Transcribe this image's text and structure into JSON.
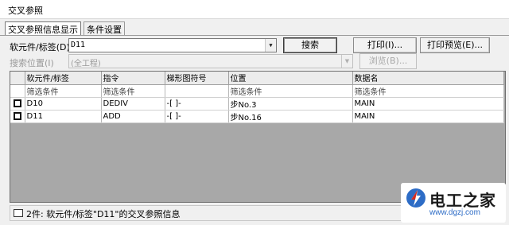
{
  "window": {
    "title": "交叉参照"
  },
  "tabs": [
    {
      "label": "交叉参照信息显示",
      "active": true
    },
    {
      "label": "条件设置",
      "active": false
    }
  ],
  "search": {
    "device_label": "软元件/标签(D)",
    "device_value": "D11",
    "search_button": "搜索",
    "location_label": "搜索位置(I)",
    "location_value": "(全工程)",
    "browse_button": "浏览(B)...",
    "print_button": "打印(I)...",
    "print_preview_button": "打印预览(E)..."
  },
  "grid": {
    "columns": [
      "软元件/标签",
      "指令",
      "梯形图符号",
      "位置",
      "数据名"
    ],
    "filter_row": [
      "筛选条件",
      "筛选条件",
      "",
      "筛选条件",
      "筛选条件"
    ],
    "rows": [
      {
        "device": "D10",
        "instruction": "DEDIV",
        "symbol": "-[ ]-",
        "location": "步No.3",
        "data_name": "MAIN"
      },
      {
        "device": "D11",
        "instruction": "ADD",
        "symbol": "-[ ]-",
        "location": "步No.16",
        "data_name": "MAIN"
      }
    ]
  },
  "status": {
    "text": "2件: 软元件/标签\"D11\"的交叉参照信息"
  },
  "watermark": {
    "name": "电工之家",
    "url": "www.dgzj.com"
  },
  "colors": {
    "grid_background": "#a8a8a8",
    "watermark_blue": "#2d6cc6",
    "watermark_red": "#d62b1f"
  }
}
